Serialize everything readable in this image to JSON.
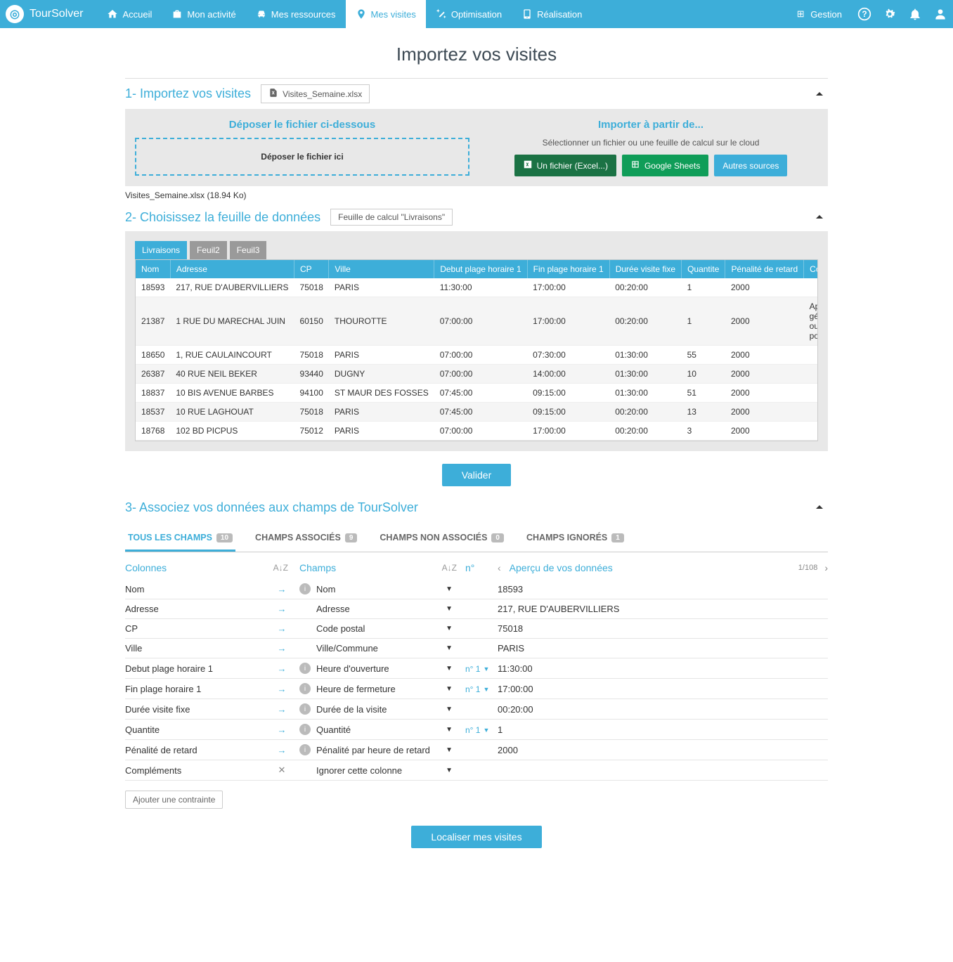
{
  "brand": "TourSolver",
  "nav": {
    "items": [
      {
        "label": "Accueil",
        "icon": "home"
      },
      {
        "label": "Mon activité",
        "icon": "briefcase"
      },
      {
        "label": "Mes ressources",
        "icon": "car"
      },
      {
        "label": "Mes visites",
        "icon": "pin",
        "active": true
      },
      {
        "label": "Optimisation",
        "icon": "wand"
      },
      {
        "label": "Réalisation",
        "icon": "tablet"
      }
    ],
    "right": {
      "gestion": "Gestion"
    }
  },
  "page_title": "Importez vos visites",
  "step1": {
    "title": "1- Importez vos visites",
    "file_chip": "Visites_Semaine.xlsx",
    "drop_title": "Déposer le fichier ci-dessous",
    "drop_label": "Déposer le fichier ici",
    "cloud_title": "Importer à partir de...",
    "cloud_hint": "Sélectionner un fichier ou une feuille de calcul sur le cloud",
    "btn_excel": "Un fichier (Excel...)",
    "btn_sheets": "Google Sheets",
    "btn_other": "Autres sources",
    "file_info": "Visites_Semaine.xlsx (18.94 Ko)"
  },
  "step2": {
    "title": "2- Choisissez la feuille de données",
    "subtitle_chip": "Feuille de calcul \"Livraisons\"",
    "tabs": [
      "Livraisons",
      "Feuil2",
      "Feuil3"
    ],
    "active_tab": 0,
    "headers": [
      "Nom",
      "Adresse",
      "CP",
      "Ville",
      "Debut plage horaire 1",
      "Fin plage horaire 1",
      "Durée visite fixe",
      "Quantite",
      "Pénalité de retard",
      "Compléments"
    ],
    "rows": [
      [
        "18593",
        "217, RUE D'AUBERVILLIERS",
        "75018",
        "PARIS",
        "11:30:00",
        "17:00:00",
        "00:20:00",
        "1",
        "2000",
        ""
      ],
      [
        "21387",
        "1 RUE DU MARECHAL JUIN",
        "60150",
        "THOUROTTE",
        "07:00:00",
        "17:00:00",
        "00:20:00",
        "1",
        "2000",
        "Appeler gérant pour ouverture portail"
      ],
      [
        "18650",
        "1, RUE CAULAINCOURT",
        "75018",
        "PARIS",
        "07:00:00",
        "07:30:00",
        "01:30:00",
        "55",
        "2000",
        ""
      ],
      [
        "26387",
        "40 RUE NEIL BEKER",
        "93440",
        "DUGNY",
        "07:00:00",
        "14:00:00",
        "01:30:00",
        "10",
        "2000",
        ""
      ],
      [
        "18837",
        "10 BIS AVENUE BARBES",
        "94100",
        "ST MAUR DES FOSSES",
        "07:45:00",
        "09:15:00",
        "01:30:00",
        "51",
        "2000",
        ""
      ],
      [
        "18537",
        "10 RUE LAGHOUAT",
        "75018",
        "PARIS",
        "07:45:00",
        "09:15:00",
        "00:20:00",
        "13",
        "2000",
        ""
      ],
      [
        "18768",
        "102 BD PICPUS",
        "75012",
        "PARIS",
        "07:00:00",
        "17:00:00",
        "00:20:00",
        "3",
        "2000",
        ""
      ]
    ],
    "validate": "Valider"
  },
  "step3": {
    "title": "3- Associez vos données aux champs de TourSolver",
    "tabs": [
      {
        "label": "TOUS LES CHAMPS",
        "count": "10",
        "active": true
      },
      {
        "label": "CHAMPS ASSOCIÉS",
        "count": "9"
      },
      {
        "label": "CHAMPS NON ASSOCIÉS",
        "count": "0"
      },
      {
        "label": "CHAMPS IGNORÉS",
        "count": "1"
      }
    ],
    "col_headers": {
      "colonnes": "Colonnes",
      "champs": "Champs",
      "num": "n°",
      "apercu": "Aperçu de vos données"
    },
    "preview_nav": "1/108",
    "rows": [
      {
        "col": "Nom",
        "arrow": true,
        "info": true,
        "field": "Nom",
        "num": "",
        "preview": "18593"
      },
      {
        "col": "Adresse",
        "arrow": true,
        "info": false,
        "field": "Adresse",
        "num": "",
        "preview": "217, RUE D'AUBERVILLIERS"
      },
      {
        "col": "CP",
        "arrow": true,
        "info": false,
        "field": "Code postal",
        "num": "",
        "preview": "75018"
      },
      {
        "col": "Ville",
        "arrow": true,
        "info": false,
        "field": "Ville/Commune",
        "num": "",
        "preview": "PARIS"
      },
      {
        "col": "Debut plage horaire 1",
        "arrow": true,
        "info": true,
        "field": "Heure d'ouverture",
        "num": "n° 1",
        "preview": "11:30:00"
      },
      {
        "col": "Fin plage horaire 1",
        "arrow": true,
        "info": true,
        "field": "Heure de fermeture",
        "num": "n° 1",
        "preview": "17:00:00"
      },
      {
        "col": "Durée visite fixe",
        "arrow": true,
        "info": true,
        "field": "Durée de la visite",
        "num": "",
        "preview": "00:20:00"
      },
      {
        "col": "Quantite",
        "arrow": true,
        "info": true,
        "field": "Quantité",
        "num": "n° 1",
        "preview": "1"
      },
      {
        "col": "Pénalité de retard",
        "arrow": true,
        "info": true,
        "field": "Pénalité par heure de retard",
        "num": "",
        "preview": "2000"
      },
      {
        "col": "Compléments",
        "arrow": false,
        "info": false,
        "field": "Ignorer cette colonne",
        "num": "",
        "preview": ""
      }
    ],
    "add_constraint": "Ajouter une contrainte",
    "locate": "Localiser mes visites"
  }
}
